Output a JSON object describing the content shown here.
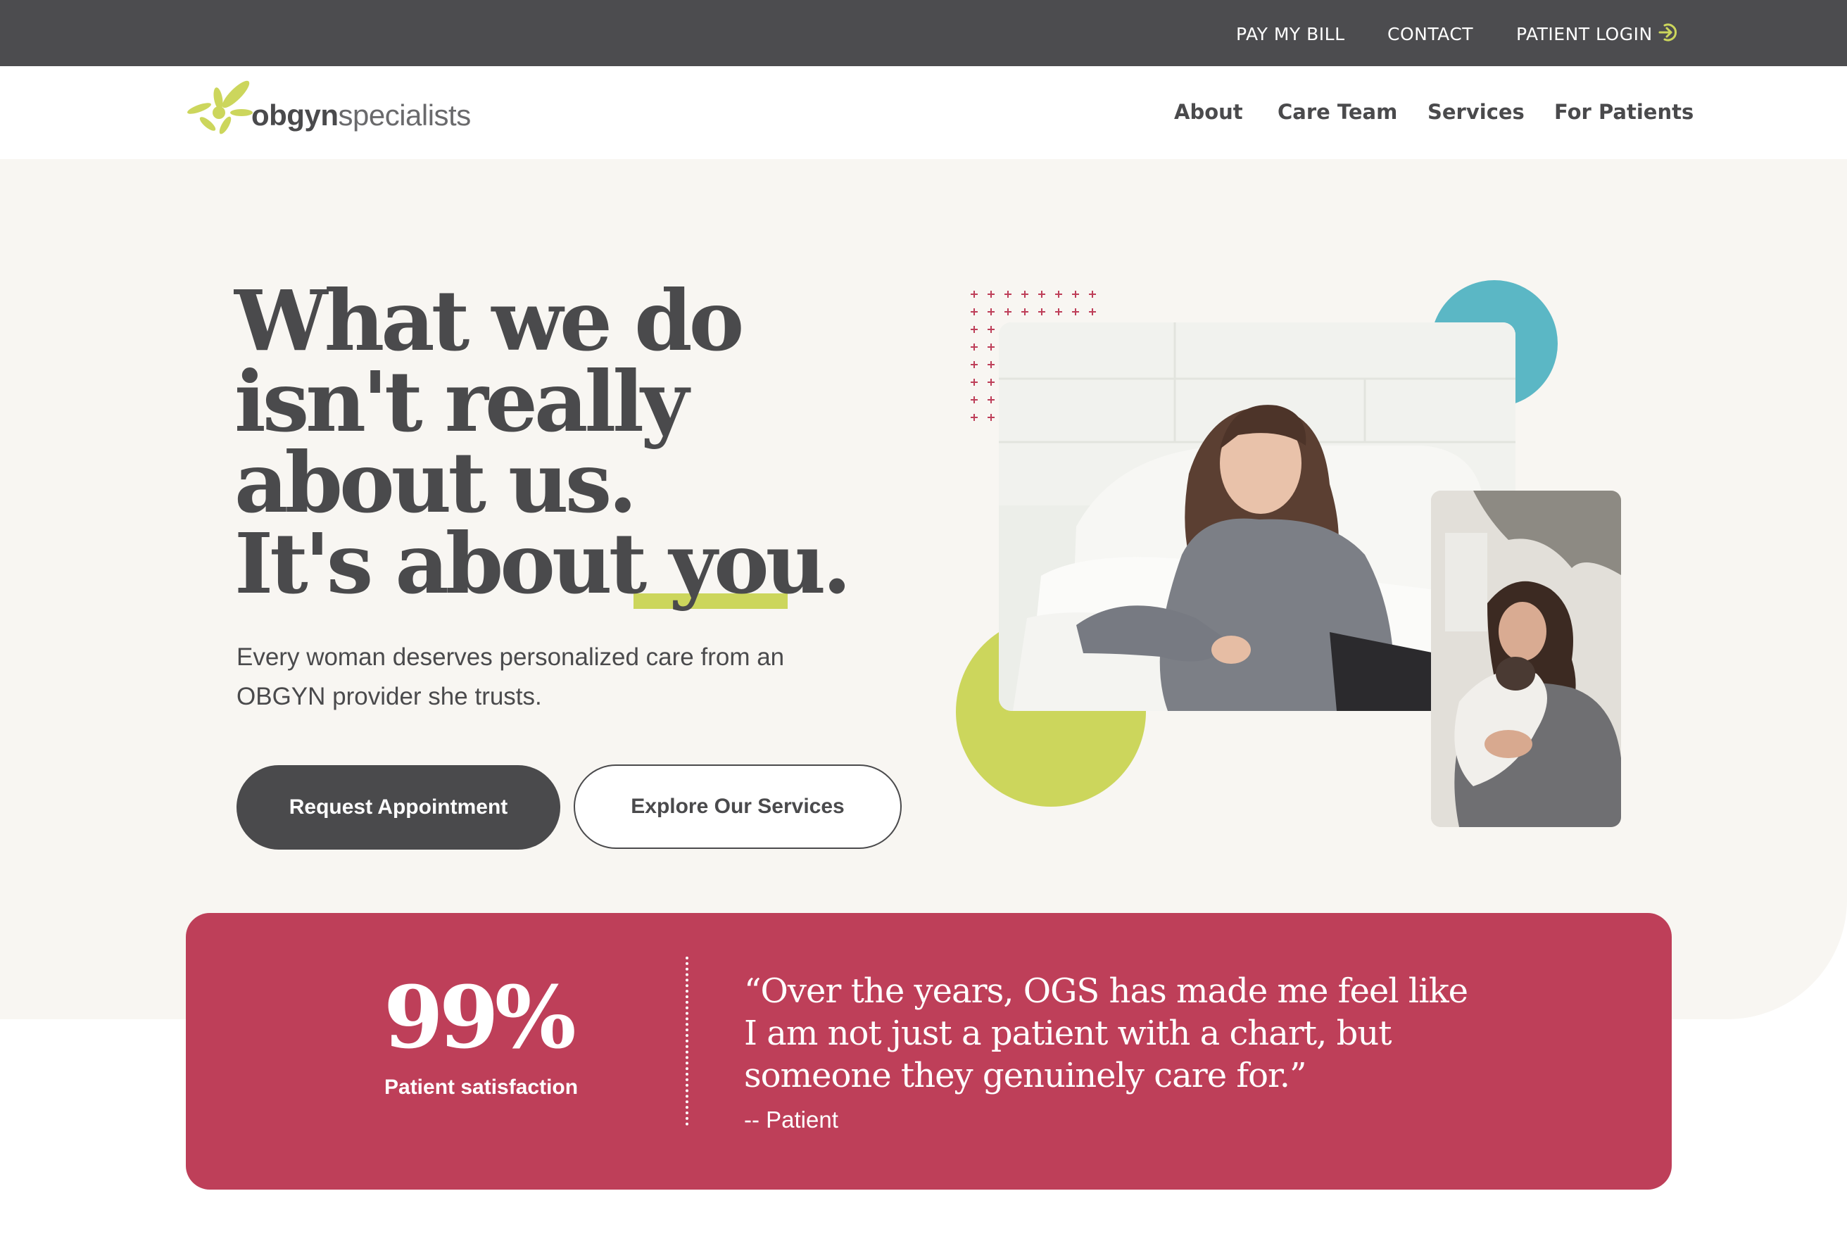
{
  "utility_nav": {
    "pay_bill": "PAY MY BILL",
    "contact": "CONTACT",
    "patient_login": "PATIENT LOGIN",
    "login_icon": "login-arrow-icon"
  },
  "header": {
    "logo_primary": "obgyn",
    "logo_secondary": "specialists",
    "nav": [
      "About",
      "Care Team",
      "Services",
      "For Patients"
    ]
  },
  "hero": {
    "headline": [
      "What we do",
      "isn't really",
      "about us.",
      "It's about "
    ],
    "headline_emphasis": "you",
    "headline_end": ".",
    "subtext": "Every woman deserves personalized care from an OBGYN provider she trusts.",
    "primary_cta": "Request Appointment",
    "secondary_cta": "Explore Our Services"
  },
  "stat_banner": {
    "stat_value": "99%",
    "stat_label": "Patient satisfaction",
    "quote": "“Over the years, OGS has made me feel like I am not just a patient with a chart, but someone they genuinely care for.”",
    "quote_author": "-- Patient"
  },
  "colors": {
    "utility_bar": "#4c4c4f",
    "text_dark": "#4a4a4c",
    "hero_bg": "#f8f6f2",
    "accent_lime": "#ccd65c",
    "accent_teal": "#5bb7c5",
    "accent_red": "#be3f59"
  }
}
